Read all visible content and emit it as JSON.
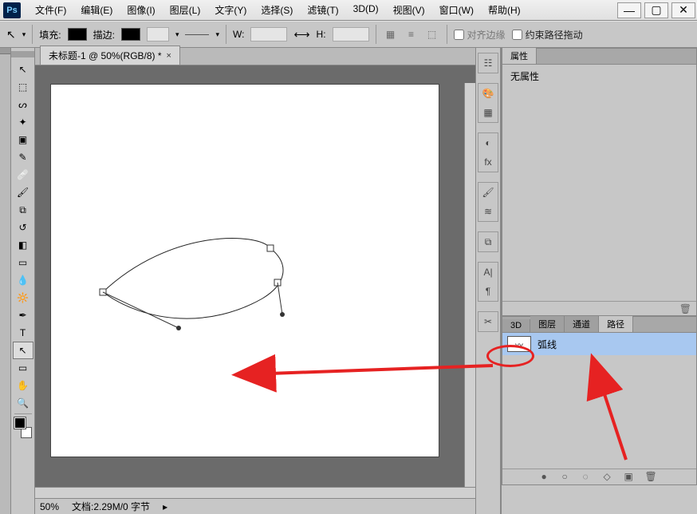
{
  "app": {
    "logo": "Ps"
  },
  "menu": {
    "file": "文件(F)",
    "edit": "编辑(E)",
    "image": "图像(I)",
    "layer": "图层(L)",
    "type": "文字(Y)",
    "select": "选择(S)",
    "filter": "滤镜(T)",
    "threeD": "3D(D)",
    "view": "视图(V)",
    "window": "窗口(W)",
    "help": "帮助(H)"
  },
  "options": {
    "fill_label": "填充:",
    "stroke_label": "描边:",
    "stroke_width": "",
    "w_label": "W:",
    "h_label": "H:",
    "align_label": "对齐边缘",
    "constrain_label": "约束路径拖动"
  },
  "document": {
    "tab_title": "未标题-1 @ 50%(RGB/8) *",
    "zoom": "50%",
    "doc_info": "文档:2.29M/0 字节"
  },
  "panels": {
    "properties_tab": "属性",
    "no_properties": "无属性",
    "threeD_tab": "3D",
    "layers_tab": "图层",
    "channels_tab": "通道",
    "paths_tab": "路径",
    "path_name": "弧线"
  }
}
